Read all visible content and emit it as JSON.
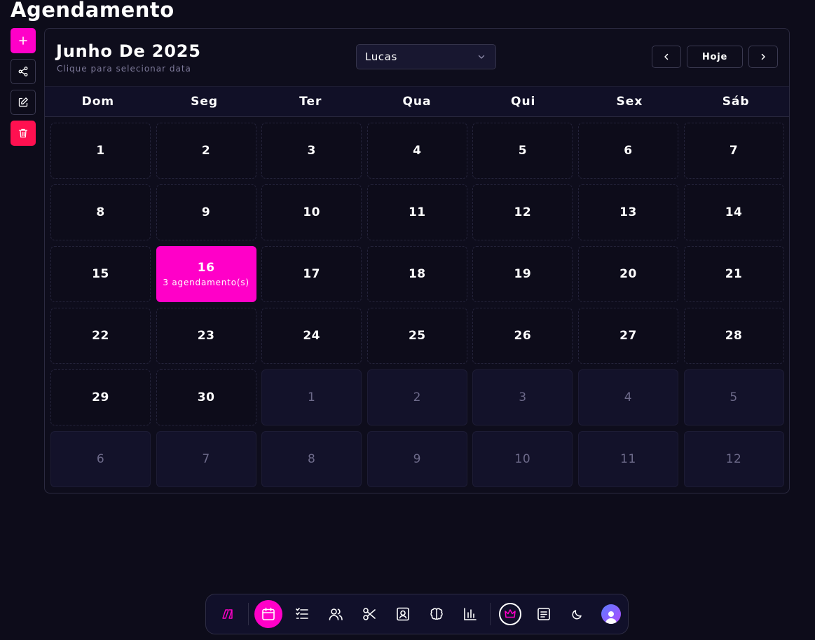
{
  "page": {
    "title": "Agendamento"
  },
  "side_actions": [
    {
      "icon": "plus-icon"
    },
    {
      "icon": "share-icon"
    },
    {
      "icon": "edit-icon"
    },
    {
      "icon": "trash-icon"
    }
  ],
  "calendar": {
    "month_title": "Junho De 2025",
    "subtitle": "Clique para selecionar data",
    "professional": "Lucas",
    "today_label": "Hoje",
    "weekdays": [
      "Dom",
      "Seg",
      "Ter",
      "Qua",
      "Qui",
      "Sex",
      "Sáb"
    ],
    "days": [
      {
        "n": "1"
      },
      {
        "n": "2"
      },
      {
        "n": "3"
      },
      {
        "n": "4"
      },
      {
        "n": "5"
      },
      {
        "n": "6"
      },
      {
        "n": "7"
      },
      {
        "n": "8"
      },
      {
        "n": "9"
      },
      {
        "n": "10"
      },
      {
        "n": "11"
      },
      {
        "n": "12"
      },
      {
        "n": "13"
      },
      {
        "n": "14"
      },
      {
        "n": "15"
      },
      {
        "n": "16",
        "selected": true,
        "appointments": "3 agendamento(s)"
      },
      {
        "n": "17"
      },
      {
        "n": "18"
      },
      {
        "n": "19"
      },
      {
        "n": "20"
      },
      {
        "n": "21"
      },
      {
        "n": "22"
      },
      {
        "n": "23"
      },
      {
        "n": "24"
      },
      {
        "n": "25"
      },
      {
        "n": "26"
      },
      {
        "n": "27"
      },
      {
        "n": "28"
      },
      {
        "n": "29"
      },
      {
        "n": "30"
      },
      {
        "n": "1",
        "other": true
      },
      {
        "n": "2",
        "other": true
      },
      {
        "n": "3",
        "other": true
      },
      {
        "n": "4",
        "other": true
      },
      {
        "n": "5",
        "other": true
      },
      {
        "n": "6",
        "other": true
      },
      {
        "n": "7",
        "other": true
      },
      {
        "n": "8",
        "other": true
      },
      {
        "n": "9",
        "other": true
      },
      {
        "n": "10",
        "other": true
      },
      {
        "n": "11",
        "other": true
      },
      {
        "n": "12",
        "other": true
      }
    ]
  },
  "dock": {
    "items": [
      {
        "icon": "logo-icon"
      },
      {
        "icon": "calendar-icon",
        "active": true
      },
      {
        "icon": "list-icon"
      },
      {
        "icon": "users-icon"
      },
      {
        "icon": "scissors-icon"
      },
      {
        "icon": "contact-icon"
      },
      {
        "icon": "brain-icon"
      },
      {
        "icon": "bar-chart-icon"
      },
      {
        "icon": "crown-icon"
      },
      {
        "icon": "notes-icon"
      },
      {
        "icon": "moon-icon"
      },
      {
        "icon": "avatar-icon"
      }
    ]
  },
  "colors": {
    "accent": "#ff00c8",
    "danger": "#ff1050",
    "background": "#0d0c1a"
  }
}
